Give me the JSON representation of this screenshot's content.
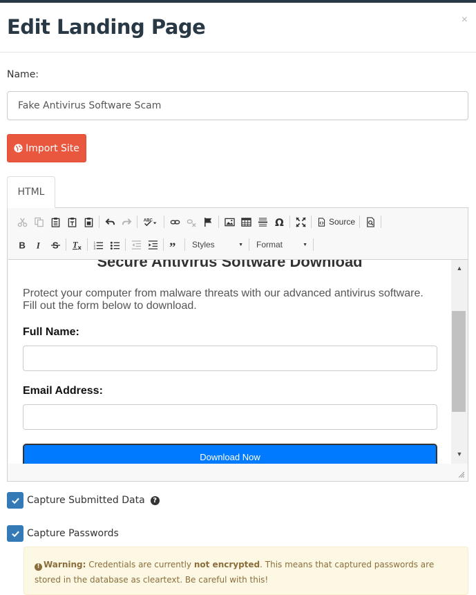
{
  "modal": {
    "title": "Edit Landing Page",
    "close_glyph": "×"
  },
  "form": {
    "name_label": "Name:",
    "name_value": "Fake Antivirus Software Scam",
    "import_button": "Import Site"
  },
  "tabs": [
    {
      "label": "HTML"
    }
  ],
  "toolbar": {
    "row1_icons": [
      "cut-icon",
      "copy-icon",
      "paste-icon",
      "paste-text-icon",
      "paste-from-word-icon",
      "undo-icon",
      "redo-icon",
      "spellcheck-icon",
      "link-icon",
      "unlink-icon",
      "anchor-flag-icon",
      "image-icon",
      "table-icon",
      "horizontal-line-icon",
      "special-char-omega-icon",
      "maximize-icon",
      "source-icon",
      "preview-icon"
    ],
    "source_label": "Source",
    "row2_icons": [
      "bold-icon",
      "italic-icon",
      "strikethrough-icon",
      "remove-format-icon",
      "numbered-list-icon",
      "bulleted-list-icon",
      "outdent-icon",
      "indent-icon",
      "blockquote-icon"
    ],
    "styles_label": "Styles",
    "format_label": "Format"
  },
  "content": {
    "heading": "Secure Antivirus Software Download",
    "intro": "Protect your computer from malware threats with our advanced antivirus software. Fill out the form below to download.",
    "full_name_label": "Full Name:",
    "email_label": "Email Address:",
    "download_button": "Download Now"
  },
  "options": {
    "capture_data_label": "Capture Submitted Data",
    "capture_data_checked": true,
    "capture_passwords_label": "Capture Passwords",
    "capture_passwords_checked": true
  },
  "warning": {
    "prefix": "Warning:",
    "text_before": "Credentials are currently",
    "emphasis": "not encrypted",
    "text_after": ". This means that captured passwords are stored in the database as cleartext. Be careful with this!"
  },
  "colors": {
    "title": "#283845",
    "import_button": "#e9573f",
    "checkbox": "#337ab7",
    "download_button": "#007bff",
    "warning_bg": "#fcf8e3",
    "warning_text": "#8a6d3b"
  }
}
